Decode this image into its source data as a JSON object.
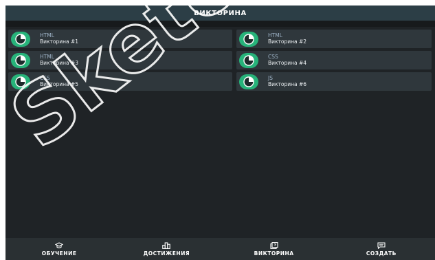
{
  "header": {
    "title": "ВИКТОРИНА"
  },
  "quizzes": [
    {
      "topic": "HTML",
      "name": "Викторина #1"
    },
    {
      "topic": "HTML",
      "name": "Викторина #2"
    },
    {
      "topic": "HTML",
      "name": "Викторина #3"
    },
    {
      "topic": "CSS",
      "name": "Викторина #4"
    },
    {
      "topic": "CSS",
      "name": "Викторина #5"
    },
    {
      "topic": "JS",
      "name": "Викторина #6"
    }
  ],
  "nav": {
    "items": [
      {
        "label": "ОБУЧЕНИЕ",
        "icon": "graduation-cap-icon"
      },
      {
        "label": "ДОСТИЖЕНИЯ",
        "icon": "podium-icon"
      },
      {
        "label": "ВИКТОРИНА",
        "icon": "quiz-icon"
      },
      {
        "label": "СОЗДАТЬ",
        "icon": "message-icon"
      }
    ]
  },
  "watermark": {
    "text": "Sketchy"
  },
  "colors": {
    "background": "#1f2326",
    "header": "#2c3e46",
    "card": "#2f373c",
    "accent": "#27b37a",
    "topic_text": "#9fb4c8"
  }
}
